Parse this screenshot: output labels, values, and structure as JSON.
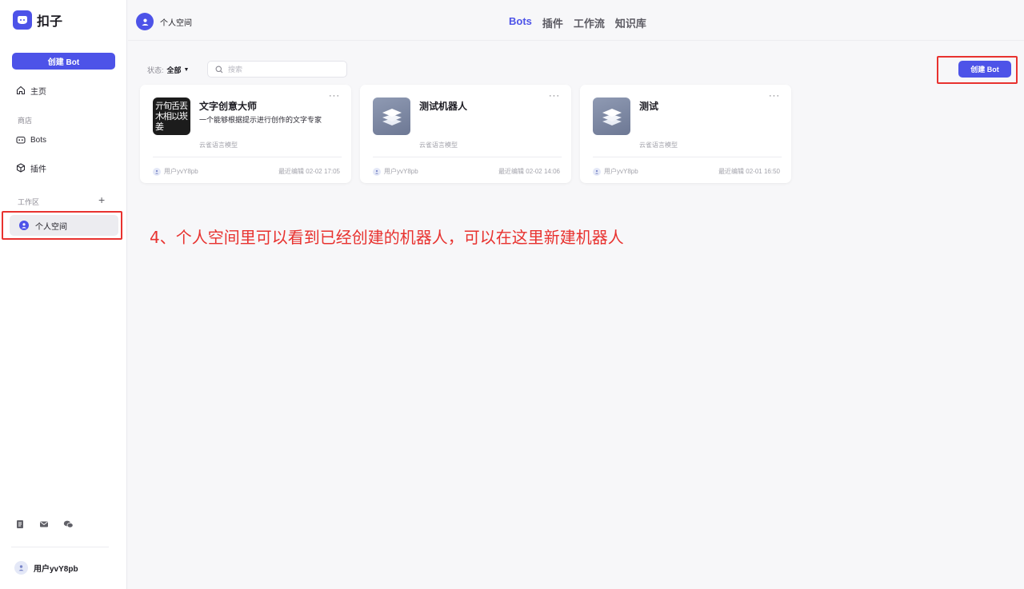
{
  "brand": {
    "name": "扣子"
  },
  "sidebar": {
    "create_label": "创建 Bot",
    "home": "主页",
    "section_discover": "商店",
    "bots": "Bots",
    "plugins": "插件",
    "section_workspace": "工作区",
    "personal_space": "个人空间",
    "user_name": "用户yvY8pb"
  },
  "header": {
    "space_name": "个人空间",
    "tabs": [
      "Bots",
      "插件",
      "工作流",
      "知识库"
    ]
  },
  "toolbar": {
    "status_label": "状态:",
    "status_value": "全部",
    "search_placeholder": "搜索",
    "create_label": "创建 Bot"
  },
  "cards": [
    {
      "title": "文字创意大师",
      "desc": "一个能够根据提示进行创作的文字专家",
      "model": "云雀语言模型",
      "owner": "用户yvY8pb",
      "edited": "最近编辑 02-02 17:05",
      "thumb_text": "亓旬舌丟木相以崁姜"
    },
    {
      "title": "测试机器人",
      "desc": "",
      "model": "云雀语言模型",
      "owner": "用户yvY8pb",
      "edited": "最近编辑 02-02 14:06"
    },
    {
      "title": "测试",
      "desc": "",
      "model": "云雀语言模型",
      "owner": "用户yvY8pb",
      "edited": "最近编辑 02-01 16:50"
    }
  ],
  "annotation": "4、个人空间里可以看到已经创建的机器人，可以在这里新建机器人",
  "colors": {
    "accent": "#4d53e8",
    "annotation": "#e8322f"
  }
}
